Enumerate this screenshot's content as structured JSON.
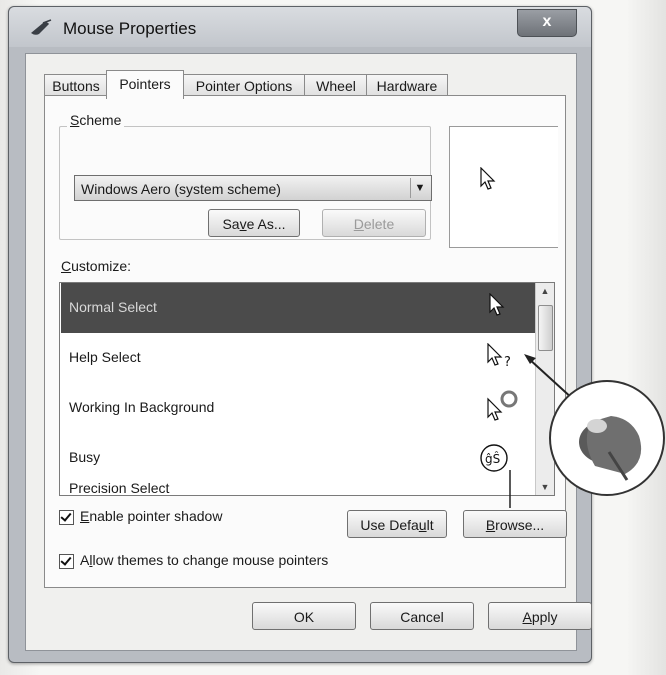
{
  "window": {
    "title": "Mouse Properties",
    "close_label": "x"
  },
  "tabs": [
    {
      "label": "Buttons",
      "active": false
    },
    {
      "label": "Pointers",
      "active": true
    },
    {
      "label": "Pointer Options",
      "active": false
    },
    {
      "label": "Wheel",
      "active": false
    },
    {
      "label": "Hardware",
      "active": false
    }
  ],
  "scheme": {
    "group_label_u": "S",
    "group_label_rest": "cheme",
    "selected": "Windows Aero (system scheme)",
    "save_as_pre": "Sa",
    "save_as_u": "v",
    "save_as_post": "e As...",
    "delete_u": "D",
    "delete_rest": "elete"
  },
  "customize": {
    "label_u": "C",
    "label_rest": "ustomize:",
    "items": [
      {
        "label": "Normal Select",
        "icon": "arrow-cursor-icon",
        "selected": true
      },
      {
        "label": "Help Select",
        "icon": "help-cursor-icon",
        "selected": false
      },
      {
        "label": "Working In Background",
        "icon": "working-cursor-icon",
        "selected": false
      },
      {
        "label": "Busy",
        "icon": "busy-cursor-icon",
        "selected": false
      },
      {
        "label": "Precision Select",
        "icon": "",
        "selected": false
      }
    ]
  },
  "options": {
    "pointer_shadow_u": "E",
    "pointer_shadow_rest": "nable pointer shadow",
    "pointer_shadow_checked": true,
    "allow_themes_pre": "A",
    "allow_themes_u": "l",
    "allow_themes_rest": "low themes to change mouse pointers",
    "allow_themes_checked": true
  },
  "buttons": {
    "use_default_pre": "Use Defa",
    "use_default_u": "u",
    "use_default_post": "lt",
    "browse_u": "B",
    "browse_rest": "rowse...",
    "ok": "OK",
    "cancel": "Cancel",
    "apply_u": "A",
    "apply_rest": "pply"
  },
  "colors": {
    "selected_row": "#4b4b4b",
    "window_frame": "#b8bcc2"
  }
}
